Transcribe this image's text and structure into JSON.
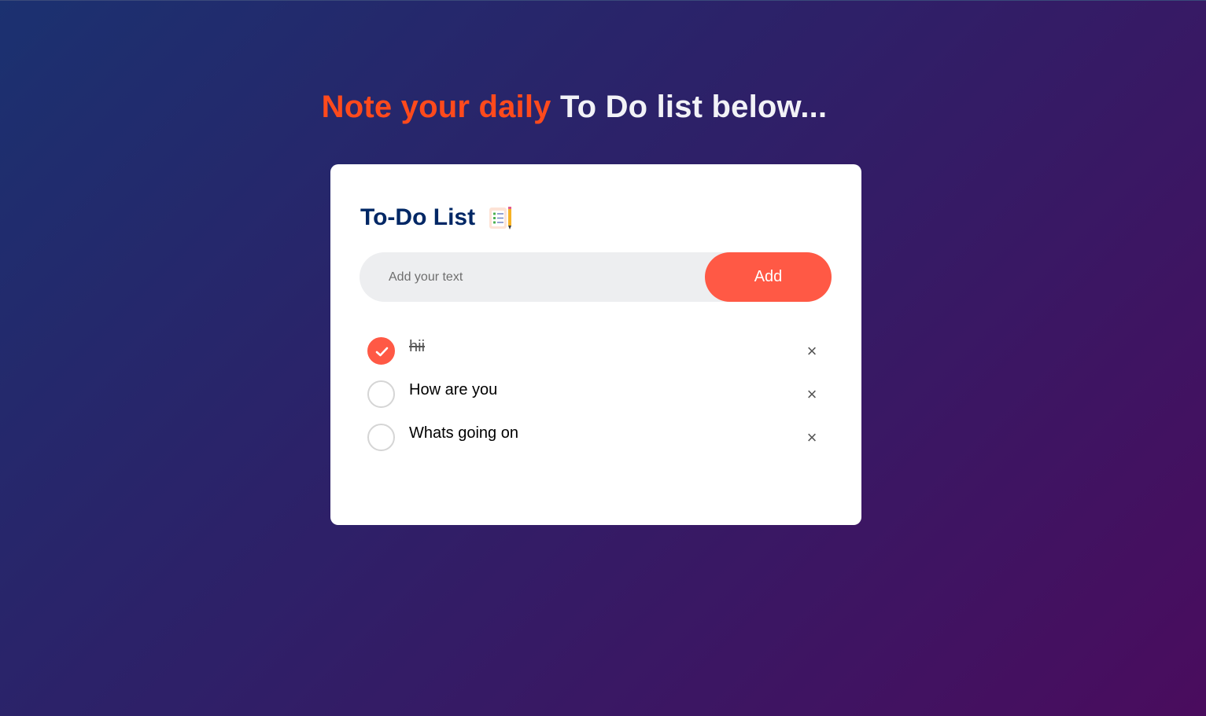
{
  "headline": {
    "accent": "Note your daily",
    "rest": "To Do list below..."
  },
  "card": {
    "title": "To-Do List",
    "title_icon": "notepad-checklist-icon"
  },
  "input": {
    "placeholder": "Add your text",
    "value": ""
  },
  "add_button": {
    "label": "Add"
  },
  "tasks": [
    {
      "text": "hii",
      "checked": true
    },
    {
      "text": "How are you",
      "checked": false
    },
    {
      "text": "Whats going on",
      "checked": false
    }
  ],
  "remove_symbol": "×",
  "colors": {
    "accent": "#ff4a1c",
    "button": "#ff5945",
    "title": "#002765"
  }
}
